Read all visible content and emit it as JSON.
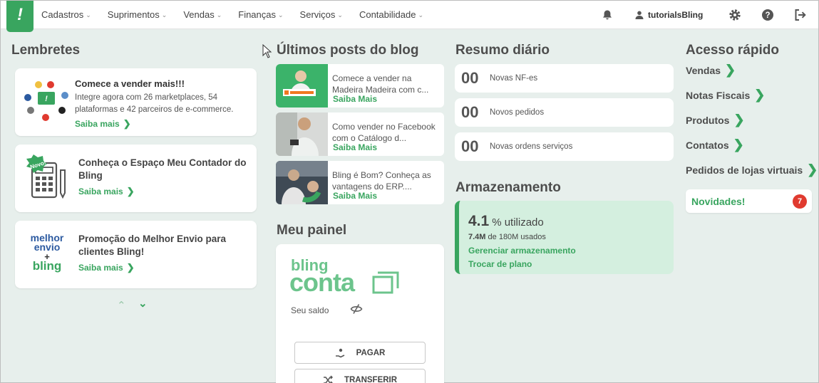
{
  "nav": {
    "logo": "!",
    "menu": [
      "Cadastros",
      "Suprimentos",
      "Vendas",
      "Finanças",
      "Serviços",
      "Contabilidade"
    ],
    "user": "tutorialsBling"
  },
  "lembretes": {
    "title": "Lembretes",
    "items": [
      {
        "title": "Comece a vender mais!!!",
        "text": "Integre agora com 26 marketplaces, 54 plataformas e 42 parceiros de e-commerce.",
        "link": "Saiba mais"
      },
      {
        "title": "Conheça o Espaço Meu Contador do Bling",
        "badge": "Novo!",
        "link": "Saiba mais"
      },
      {
        "title": "Promoção do Melhor Envio para clientes Bling!",
        "logo_top": "melhor envio",
        "logo_plus": "+",
        "logo_bottom": "bling",
        "link": "Saiba mais"
      }
    ]
  },
  "blog": {
    "title": "Últimos posts do blog",
    "posts": [
      {
        "text": "Comece a vender na Madeira Madeira com c...",
        "link": "Saiba Mais"
      },
      {
        "text": "Como vender no Facebook com o Catálogo d...",
        "link": "Saiba Mais"
      },
      {
        "text": "Bling é Bom? Conheça as vantagens do ERP....",
        "link": "Saiba Mais"
      }
    ]
  },
  "painel": {
    "title": "Meu painel",
    "brand_top": "bling",
    "brand_bottom": "conta",
    "saldo": "Seu saldo",
    "pagar": "PAGAR",
    "transferir": "TRANSFERIR"
  },
  "resumo": {
    "title": "Resumo diário",
    "items": [
      {
        "num": "00",
        "label": "Novas NF-es"
      },
      {
        "num": "00",
        "label": "Novos pedidos"
      },
      {
        "num": "00",
        "label": "Novas ordens serviços"
      }
    ]
  },
  "armazenamento": {
    "title": "Armazenamento",
    "value": "4.1",
    "unit": "% utilizado",
    "used": "7.4M",
    "used_rest": "de 180M usados",
    "link1": "Gerenciar armazenamento",
    "link2": "Trocar de plano",
    "percent_used": 4.1
  },
  "acesso": {
    "title": "Acesso rápido",
    "items": [
      "Vendas",
      "Notas Fiscais",
      "Produtos",
      "Contatos",
      "Pedidos de lojas virtuais"
    ],
    "novidades": "Novidades!",
    "novidades_count": "7"
  },
  "colors": {
    "accent": "#39a55f",
    "background": "#e7efec",
    "badge": "#e03a2f"
  }
}
